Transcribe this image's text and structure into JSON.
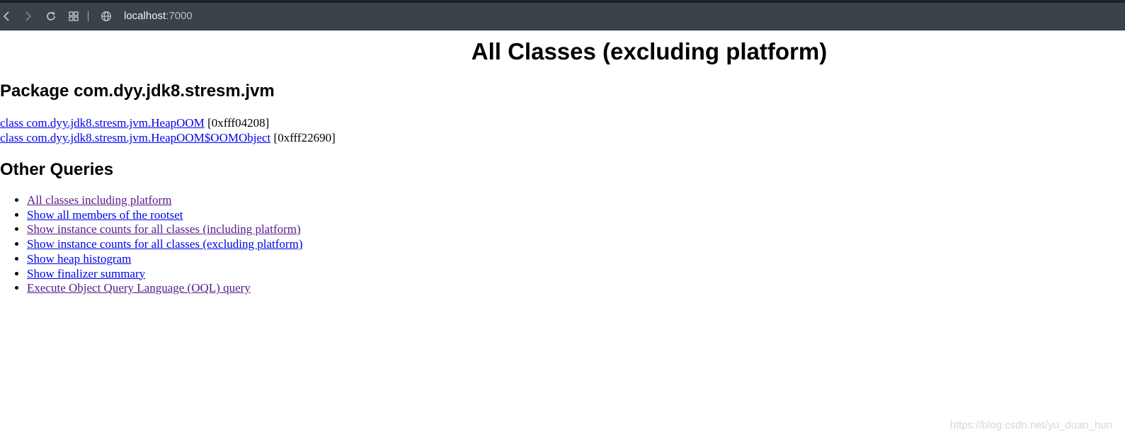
{
  "browser": {
    "url_host": "localhost",
    "url_port": ":7000",
    "icons": [
      "back-icon",
      "forward-icon",
      "reload-icon",
      "grid-icon",
      "globe-icon"
    ]
  },
  "page": {
    "title": "All Classes (excluding platform)",
    "package_heading": "Package com.dyy.jdk8.stresm.jvm",
    "classes": [
      {
        "label": "class com.dyy.jdk8.stresm.jvm.HeapOOM",
        "address": "[0xfff04208]"
      },
      {
        "label": "class com.dyy.jdk8.stresm.jvm.HeapOOM$OOMObject",
        "address": "[0xfff22690]"
      }
    ],
    "other_heading": "Other Queries",
    "queries": [
      "All classes including platform",
      "Show all members of the rootset",
      "Show instance counts for all classes (including platform)",
      "Show instance counts for all classes (excluding platform)",
      "Show heap histogram",
      "Show finalizer summary",
      "Execute Object Query Language (OQL) query"
    ]
  },
  "watermark": "https://blog.csdn.net/yu_duan_hun",
  "colors": {
    "toolbar_bg": "#3a424c",
    "link": "#0000ee",
    "visited_link": "#551a8b"
  }
}
